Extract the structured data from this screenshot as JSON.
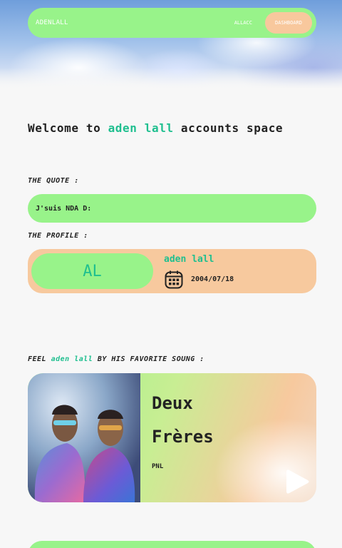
{
  "nav": {
    "brand": "ADENLALL",
    "link": "ALLACC",
    "cta": "DASHBOARD"
  },
  "welcome": {
    "prefix": "Welcome to",
    "name": "aden lall",
    "suffix": "accounts space"
  },
  "quote": {
    "label": "THE QUOTE :",
    "text": "J'suis NDA D:"
  },
  "profile": {
    "label": "THE PROFILE :",
    "initials": "AL",
    "name": "aden lall",
    "date": "2004/07/18",
    "date_icon": "calendar-icon"
  },
  "song_section": {
    "prefix": "FEEL",
    "name": "aden lall",
    "suffix": "BY HIS FAVORITE SOUNG :"
  },
  "song": {
    "title_line1": "Deux",
    "title_line2": "Frères",
    "artist": "PNL",
    "play_icon": "play-icon"
  },
  "colors": {
    "green": "#98f38a",
    "peach": "#f7c99e",
    "accent": "#1fbf8f"
  }
}
